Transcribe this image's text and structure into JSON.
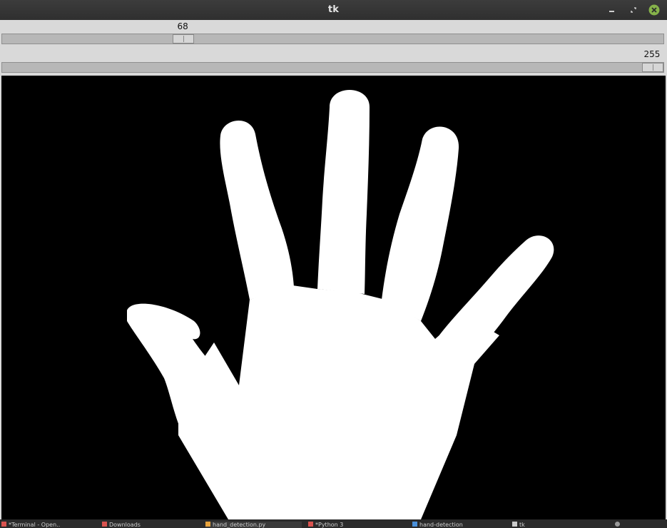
{
  "window": {
    "title": "tk",
    "controls": [
      "minimize-icon",
      "maximize-icon",
      "close-icon"
    ]
  },
  "scales": [
    {
      "value": "68",
      "level": 0.267
    },
    {
      "value": "255",
      "level": 1.0
    }
  ],
  "image": {
    "description_icon": "binary-thresholded-hand",
    "foreground": "#ffffff",
    "background": "#000000"
  },
  "taskbar": {
    "items": [
      {
        "label": "*Terminal - Open..",
        "icon_color": "#d9534f"
      },
      {
        "label": "Downloads",
        "icon_color": "#d9534f"
      },
      {
        "label": "hand_detection.py",
        "icon_color": "#e8a33c"
      },
      {
        "label": "*Python 3",
        "icon_color": "#d9534f"
      },
      {
        "label": "hand-detection",
        "icon_color": "#4a90d9"
      },
      {
        "label": "tk",
        "icon_color": "#cccccc"
      }
    ]
  },
  "colors": {
    "titlebar": "#333333",
    "close_button": "#86b34a"
  }
}
